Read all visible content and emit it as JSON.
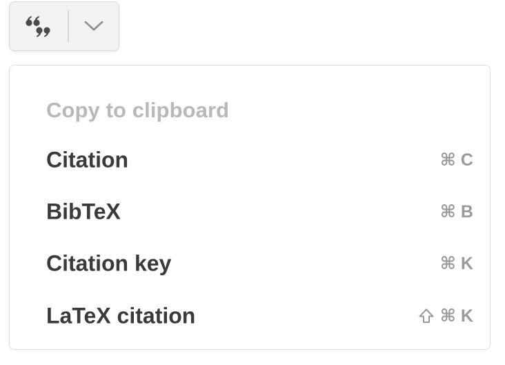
{
  "toolbar": {
    "cite_icon": "quote-icon",
    "toggle_icon": "chevron-down-icon"
  },
  "menu": {
    "heading": "Copy to clipboard",
    "items": [
      {
        "label": "Citation",
        "shortcut_prefix": "",
        "shortcut": "⌘ C"
      },
      {
        "label": "BibTeX",
        "shortcut_prefix": "",
        "shortcut": "⌘ B"
      },
      {
        "label": "Citation key",
        "shortcut_prefix": "",
        "shortcut": "⌘ K"
      },
      {
        "label": "LaTeX citation",
        "shortcut_prefix": "shift-icon",
        "shortcut": "⌘ K"
      }
    ]
  },
  "colors": {
    "heading": "#b8b8b8",
    "item_text": "#3a3a3a",
    "shortcut_text": "#9a9a9a",
    "button_bg": "#f2f2f2"
  }
}
